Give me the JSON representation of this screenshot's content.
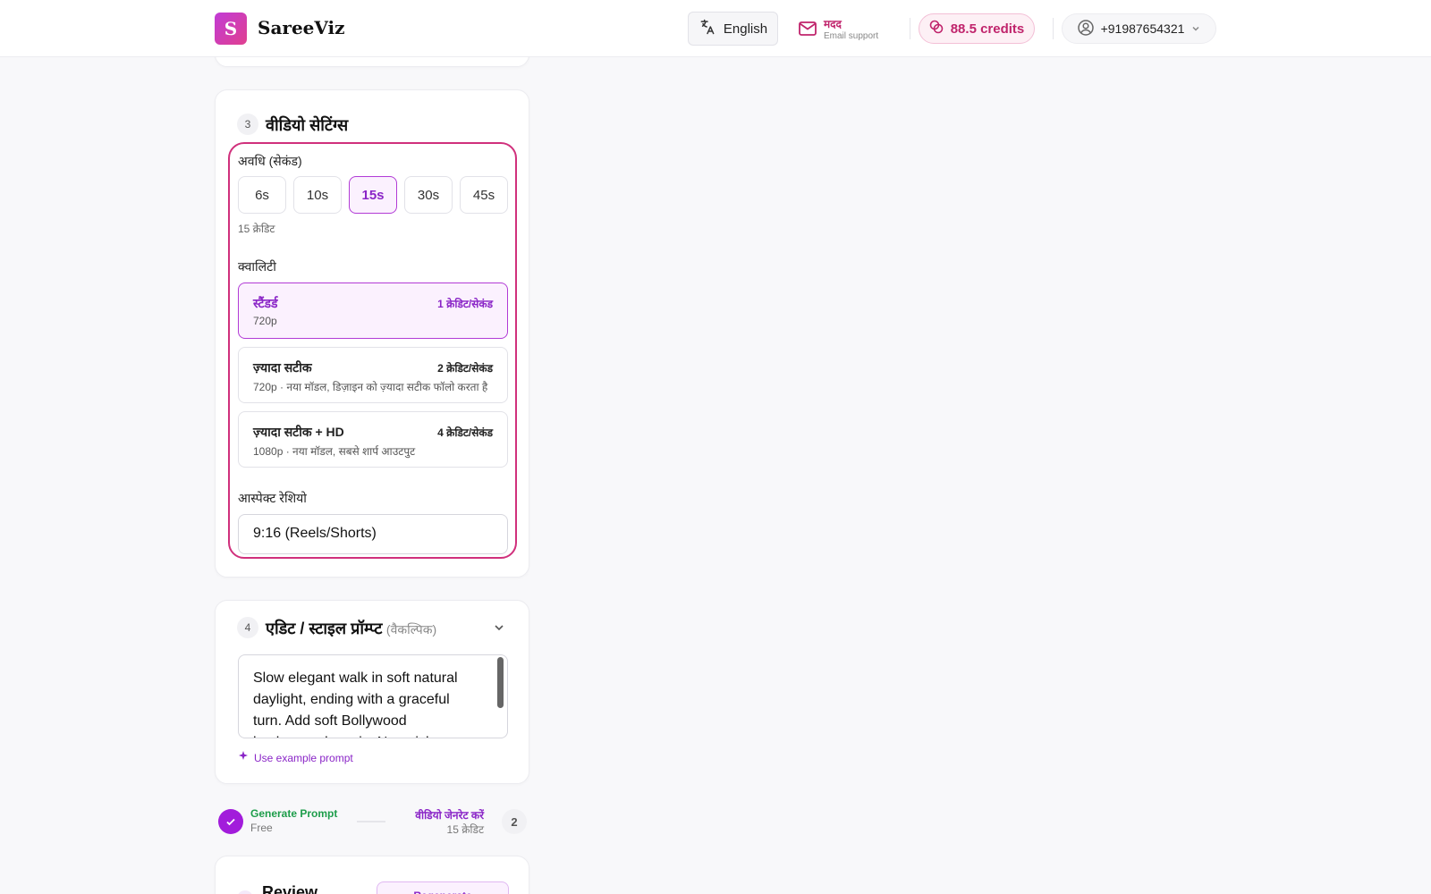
{
  "header": {
    "logo_letter": "S",
    "app_name": "SareeViz",
    "language_label": "English",
    "help_title": "मदद",
    "help_subtitle": "Email support",
    "credits_label": "88.5 credits",
    "phone": "+91987654321"
  },
  "video_settings": {
    "step": "3",
    "title": "वीडियो सेटिंग्स",
    "duration_label": "अवधि (सेकंड)",
    "durations": [
      "6s",
      "10s",
      "15s",
      "30s",
      "45s"
    ],
    "selected_duration": "15s",
    "duration_cost": "15 क्रेडिट",
    "quality_label": "क्वालिटी",
    "quality_options": [
      {
        "name": "स्टैंडर्ड",
        "price": "1 क्रेडिट/सेकंड",
        "desc": "720p",
        "selected": true
      },
      {
        "name": "ज़्यादा सटीक",
        "price": "2 क्रेडिट/सेकंड",
        "desc": "720p · नया मॉडल, डिज़ाइन को ज़्यादा सटीक फॉलो करता है",
        "selected": false
      },
      {
        "name": "ज़्यादा सटीक + HD",
        "price": "4 क्रेडिट/सेकंड",
        "desc": "1080p · नया मॉडल, सबसे शार्प आउटपुट",
        "selected": false
      }
    ],
    "aspect_label": "आस्पेक्ट रेशियो",
    "aspect_value": "9:16 (Reels/Shorts)"
  },
  "edit_prompt": {
    "step": "4",
    "title": "एडिट / स्टाइल प्रॉम्प्ट",
    "optional_label": "(वैकल्पिक)",
    "prompt_text": "Slow elegant walk in soft natural daylight, ending with a graceful turn. Add soft Bollywood background music. No quick or",
    "example_link": "Use example prompt"
  },
  "progress": {
    "step1_label": "Generate Prompt",
    "step1_sub": "Free",
    "step2_label": "वीडियो जेनरेट करें",
    "step2_sub": "15 क्रेडिट",
    "step2_num": "2"
  },
  "review": {
    "title": "Review",
    "regenerate_label": "Regenerate"
  },
  "colors": {
    "accent": "#8a25c7",
    "highlight": "#d0307c",
    "credits": "#c0246c",
    "success": "#1d9d4a"
  }
}
